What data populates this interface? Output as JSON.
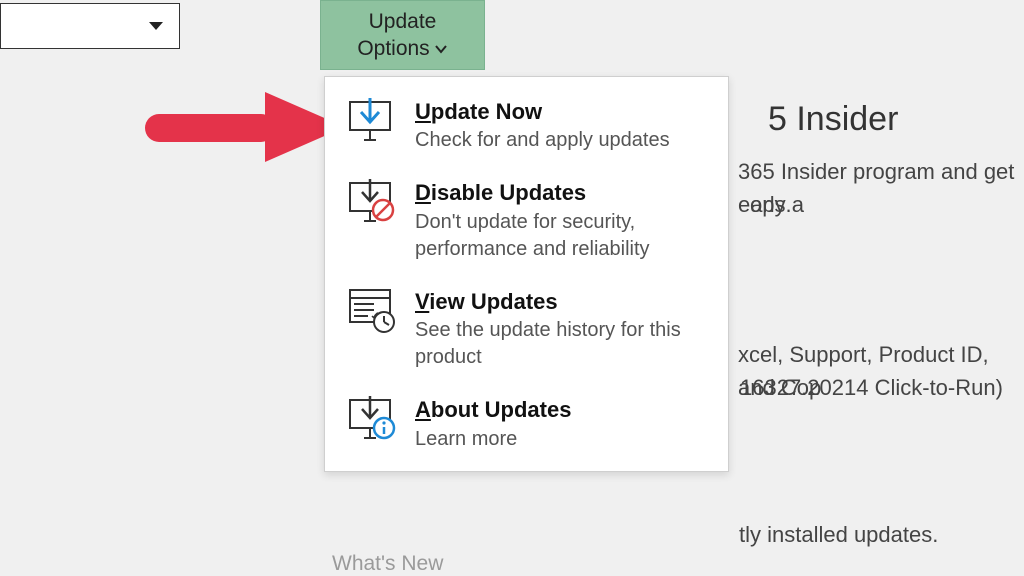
{
  "updateOptions": {
    "line1": "Update",
    "line2": "Options"
  },
  "menu": {
    "items": [
      {
        "title_pre": "U",
        "title_rest": "pdate Now",
        "desc": "Check for and apply updates"
      },
      {
        "title_pre": "D",
        "title_rest": "isable Updates",
        "desc": "Don't update for security, performance and reliability"
      },
      {
        "title_pre": "V",
        "title_rest": "iew Updates",
        "desc": "See the update history for this product"
      },
      {
        "title_pre": "A",
        "title_rest": "bout Updates",
        "desc": "Learn more"
      }
    ]
  },
  "whatsNew": "What's New",
  "bg": {
    "heading": "5 Insider",
    "line1": "365 Insider program and get early a",
    "line2": "ops.",
    "line3": "xcel, Support, Product ID, and Cop",
    "line4": " 16327.20214 Click-to-Run)",
    "line5": "tly installed updates."
  }
}
